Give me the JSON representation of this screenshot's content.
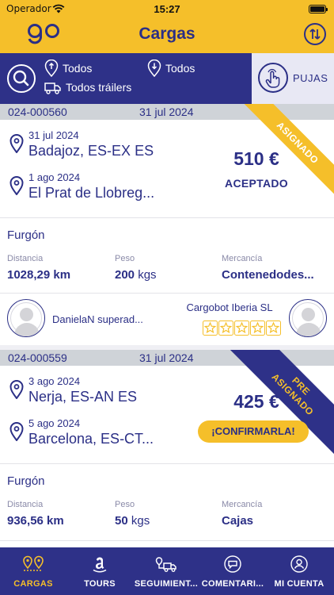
{
  "status_bar": {
    "carrier": "Operador",
    "time": "15:27"
  },
  "header": {
    "title": "Cargas",
    "logo": "go",
    "sort_icon": "sort-arrows-icon"
  },
  "filters": {
    "origin": "Todos",
    "destination": "Todos",
    "trailer": "Todos tráilers",
    "pujas_label": "PUJAS"
  },
  "loads": [
    {
      "id": "024-000560",
      "date": "31 jul 2024",
      "ribbon": "ASIGNADO",
      "pickup_date": "31 jul 2024",
      "pickup_city": "Badajoz, ES-EX ES",
      "delivery_date": "1 ago 2024",
      "delivery_city": "El Prat de Llobreg...",
      "price": "510 €",
      "status": "ACEPTADO",
      "trailer_type": "Furgón",
      "distance_label": "Distancia",
      "distance": "1028,29 km",
      "weight_label": "Peso",
      "weight": "200",
      "weight_unit": "kgs",
      "goods_label": "Mercancía",
      "goods": "Contenedodes...",
      "driver": "DanielaN superad...",
      "company": "Cargobot Iberia SL",
      "rating": 5
    },
    {
      "id": "024-000559",
      "date": "31 jul 2024",
      "extra": "-",
      "ribbon_line1": "PRE",
      "ribbon_line2": "ASIGNADO",
      "pickup_date": "3 ago 2024",
      "pickup_city": "Nerja, ES-AN ES",
      "delivery_date": "5 ago 2024",
      "delivery_city": "Barcelona, ES-CT...",
      "price": "425 €",
      "action": "¡CONFIRMARLA!",
      "trailer_type": "Furgón",
      "distance_label": "Distancia",
      "distance": "936,56 km",
      "weight_label": "Peso",
      "weight": "50",
      "weight_unit": "kgs",
      "goods_label": "Mercancía",
      "goods": "Cajas"
    }
  ],
  "tabs": [
    {
      "label": "CARGAS",
      "icon": "map-pins-icon",
      "active": true
    },
    {
      "label": "TOURS",
      "icon": "amazon-icon",
      "active": false
    },
    {
      "label": "SEGUIMIENT...",
      "icon": "truck-route-icon",
      "active": false
    },
    {
      "label": "COMENTARI...",
      "icon": "chat-icon",
      "active": false
    },
    {
      "label": "MI CUENTA",
      "icon": "user-icon",
      "active": false
    }
  ],
  "colors": {
    "brand_yellow": "#f5bf2a",
    "brand_navy": "#2e3188",
    "text_navy": "#2b2f86"
  }
}
